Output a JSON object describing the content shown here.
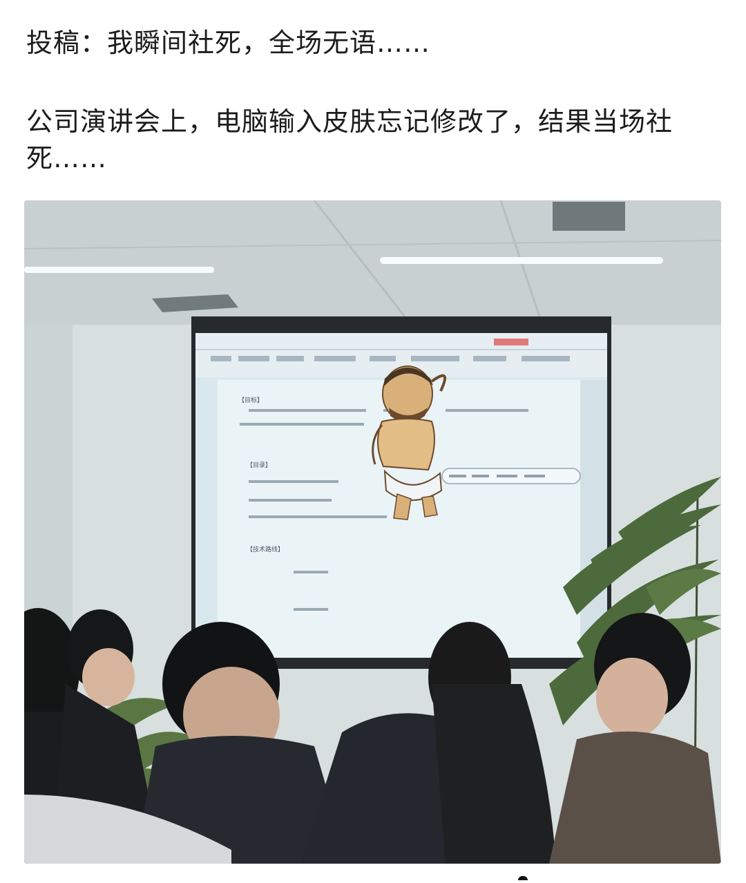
{
  "post": {
    "title": "投稿：我瞬间社死，全场无语……",
    "body": "公司演讲会上，电脑输入皮肤忘记修改了，结果当场社死……"
  },
  "slide": {
    "section_1": "【目标】",
    "section_2": "【目录】",
    "section_3": "【技术路线】"
  },
  "colors": {
    "wall": "#d9e0e0",
    "screen": "#dbe9ee",
    "ceiling": "#c6cfd0"
  }
}
